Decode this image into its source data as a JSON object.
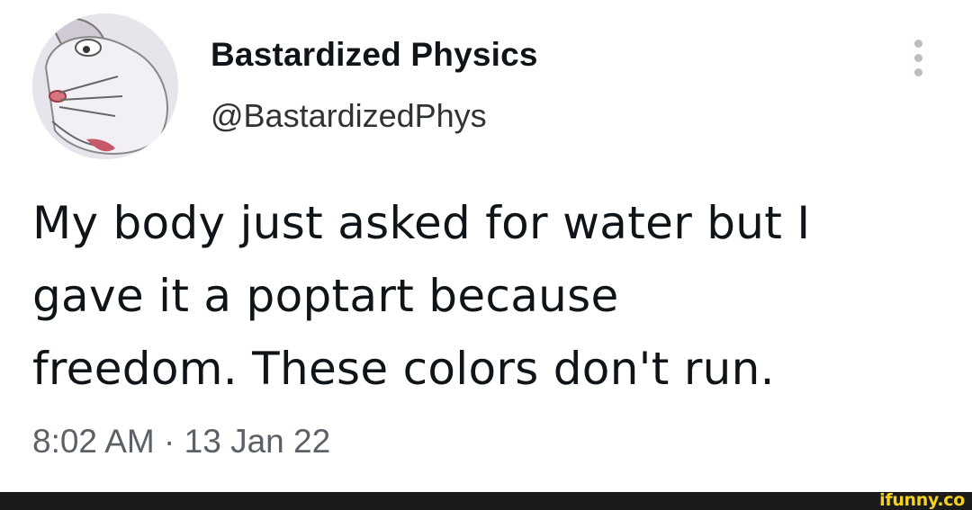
{
  "tweet": {
    "display_name": "Bastardized Physics",
    "handle": "@BastardizedPhys",
    "text_lines": [
      "My body just asked for water but I",
      "gave it a poptart because",
      "freedom. These colors don't run."
    ],
    "timestamp": "8:02 AM · 13 Jan 22",
    "avatar_icon": "bugs-bunny-avatar-icon",
    "more_icon": "more-options-icon"
  },
  "footer": {
    "watermark": "ifunny.co"
  },
  "colors": {
    "text": "#0f1419",
    "secondary_text": "#5b6167",
    "footer_bg": "#1b1b1b",
    "watermark": "#f5d21b"
  }
}
